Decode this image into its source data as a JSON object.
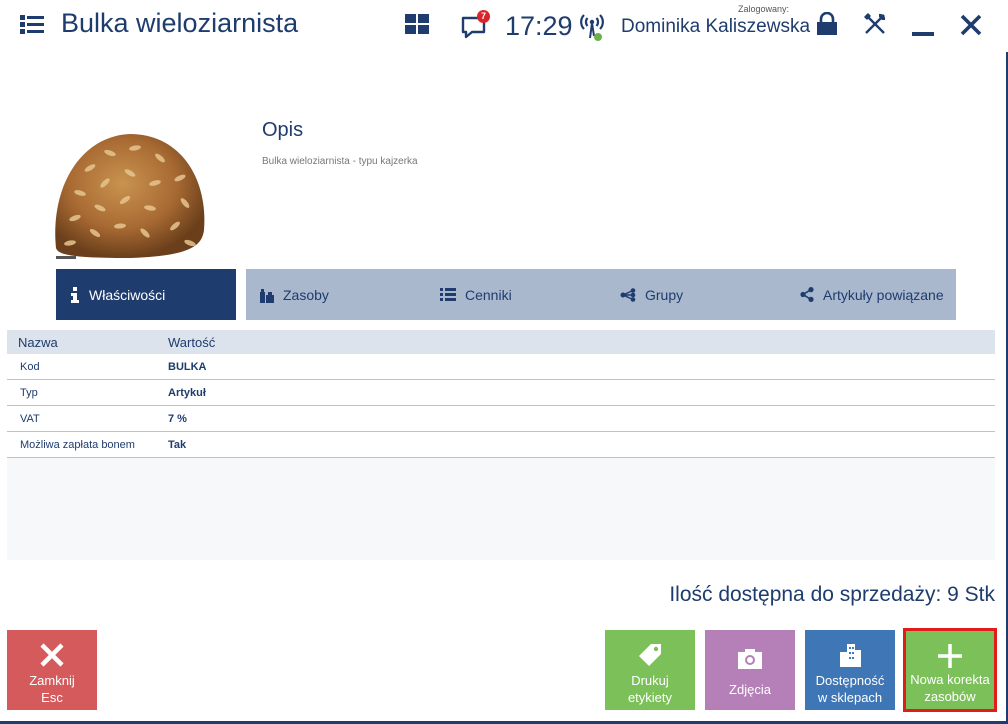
{
  "header": {
    "title": "Bulka wieloziarnista",
    "notification_count": "7",
    "time": "17:29",
    "logged_caption": "Zalogowany:",
    "user_name": "Dominika Kaliszewska"
  },
  "product": {
    "description_title": "Opis",
    "description_text": "Bulka wieloziarnista - typu kajzerka"
  },
  "tabs": [
    {
      "label": "Właściwości",
      "icon": "info-icon",
      "active": true
    },
    {
      "label": "Zasoby",
      "icon": "stock-icon",
      "active": false
    },
    {
      "label": "Cenniki",
      "icon": "list-icon",
      "active": false
    },
    {
      "label": "Grupy",
      "icon": "groups-icon",
      "active": false
    },
    {
      "label": "Artykuły powiązane",
      "icon": "share-icon",
      "active": false
    }
  ],
  "table": {
    "columns": [
      "Nazwa",
      "Wartość"
    ],
    "rows": [
      {
        "name": "Kod",
        "value": "BULKA"
      },
      {
        "name": "Typ",
        "value": "Artykuł"
      },
      {
        "name": "VAT",
        "value": "7 %"
      },
      {
        "name": "Możliwa zapłata bonem",
        "value": "Tak"
      }
    ]
  },
  "availability": "Ilość dostępna do sprzedaży:  9 Stk",
  "buttons": {
    "close": {
      "line1": "Zamknij",
      "line2": "Esc"
    },
    "print": {
      "line1": "Drukuj",
      "line2": "etykiety"
    },
    "photo": {
      "line1": "Zdjęcia"
    },
    "availability": {
      "line1": "Dostępność",
      "line2": "w sklepach"
    },
    "new_correction": {
      "line1": "Nowa korekta",
      "line2": "zasobów"
    }
  },
  "colors": {
    "primary": "#1e3c6e",
    "tab_inactive": "#a9b8cc",
    "close_red": "#d45a5c",
    "green": "#7cc05a",
    "purple": "#b57fb7",
    "blue": "#3f76b6",
    "highlight_border": "#e21b1b"
  }
}
